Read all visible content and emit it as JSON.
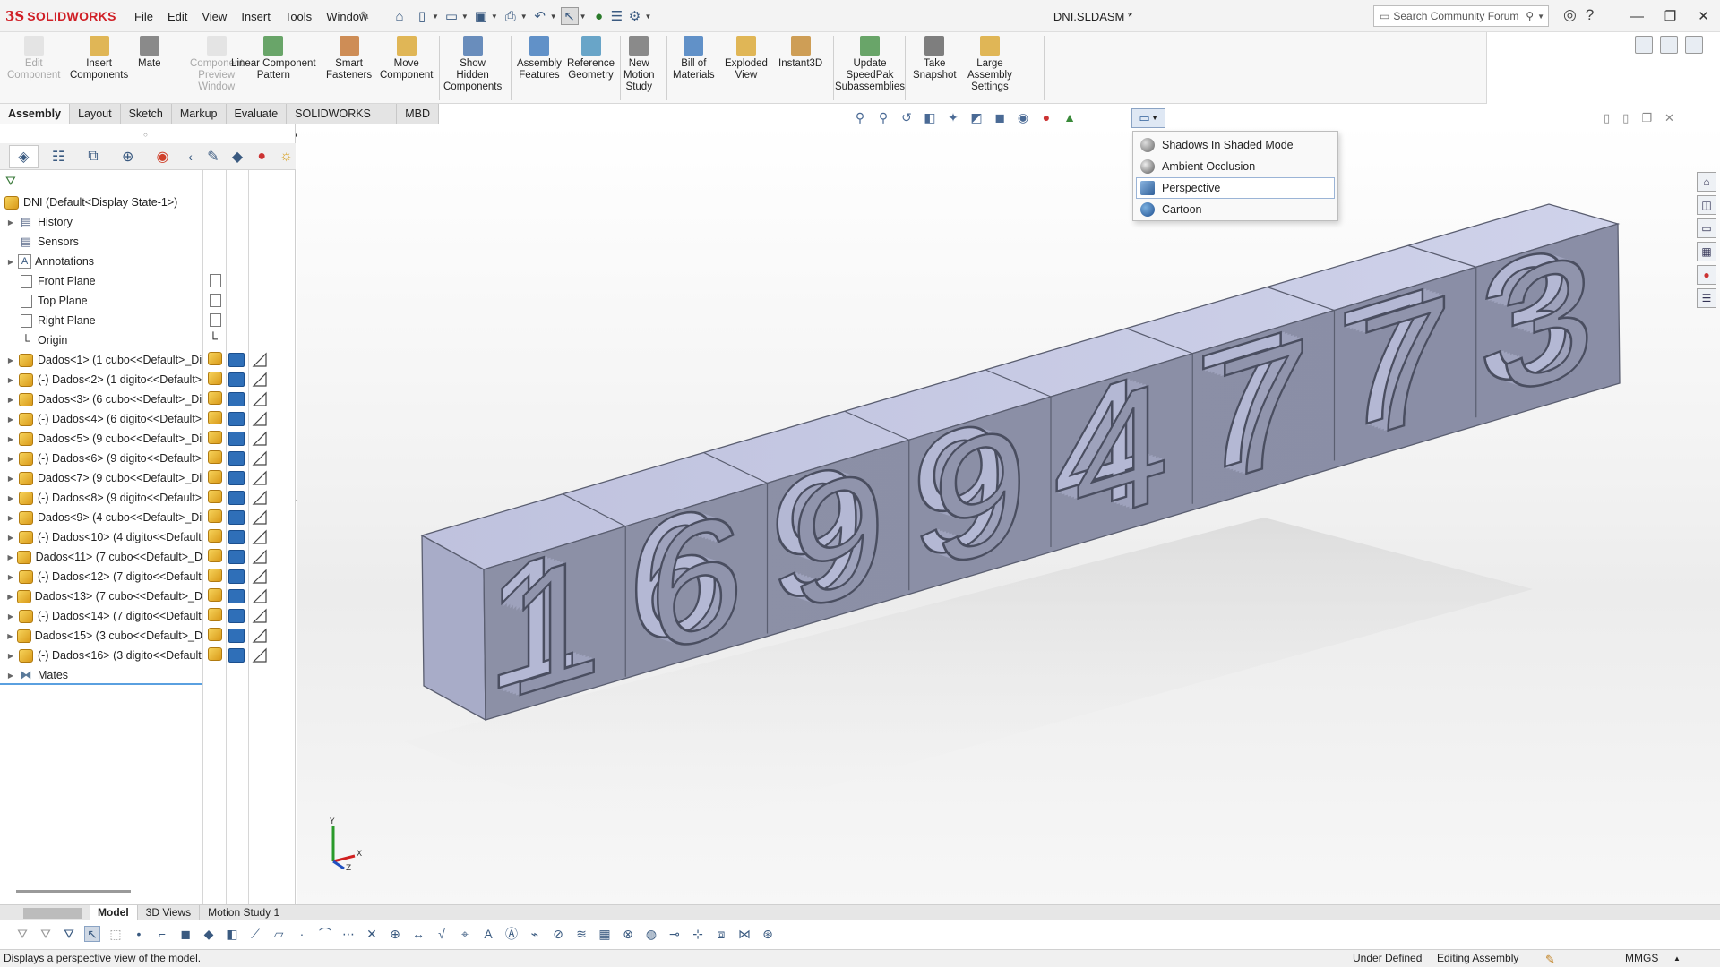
{
  "app": {
    "brand_ds": "3S",
    "brand_name": "SOLIDWORKS",
    "document_title": "DNI.SLDASM *"
  },
  "menu": [
    "File",
    "Edit",
    "View",
    "Insert",
    "Tools",
    "Window"
  ],
  "search": {
    "placeholder": "Search Community Forum"
  },
  "ribbon": {
    "items": [
      {
        "label": "Edit\nComponent",
        "enabled": false
      },
      {
        "label": "Insert\nComponents",
        "enabled": true
      },
      {
        "label": "Mate",
        "enabled": true
      },
      {
        "label": "Component\nPreview\nWindow",
        "enabled": false
      },
      {
        "label": "Linear Component\nPattern",
        "enabled": true
      },
      {
        "label": "Smart\nFasteners",
        "enabled": true
      },
      {
        "label": "Move\nComponent",
        "enabled": true
      },
      {
        "label": "Show\nHidden\nComponents",
        "enabled": true
      },
      {
        "label": "Assembly\nFeatures",
        "enabled": true
      },
      {
        "label": "Reference\nGeometry",
        "enabled": true
      },
      {
        "label": "New\nMotion\nStudy",
        "enabled": true
      },
      {
        "label": "Bill of\nMaterials",
        "enabled": true
      },
      {
        "label": "Exploded\nView",
        "enabled": true
      },
      {
        "label": "Instant3D",
        "enabled": true
      },
      {
        "label": "Update\nSpeedPak\nSubassemblies",
        "enabled": true
      },
      {
        "label": "Take\nSnapshot",
        "enabled": true
      },
      {
        "label": "Large\nAssembly\nSettings",
        "enabled": true
      }
    ]
  },
  "command_tabs": [
    {
      "label": "Assembly",
      "active": true
    },
    {
      "label": "Layout",
      "active": false
    },
    {
      "label": "Sketch",
      "active": false
    },
    {
      "label": "Markup",
      "active": false
    },
    {
      "label": "Evaluate",
      "active": false
    },
    {
      "label": "SOLIDWORKS Add-Ins",
      "active": false
    },
    {
      "label": "MBD",
      "active": false
    }
  ],
  "tree": {
    "root": "DNI  (Default<Display State-1>)",
    "items": [
      {
        "label": "History",
        "type": "folder",
        "expand": true
      },
      {
        "label": "Sensors",
        "type": "folder",
        "expand": false
      },
      {
        "label": "Annotations",
        "type": "annot",
        "expand": true
      },
      {
        "label": "Front Plane",
        "type": "plane",
        "expand": false
      },
      {
        "label": "Top Plane",
        "type": "plane",
        "expand": false
      },
      {
        "label": "Right Plane",
        "type": "plane",
        "expand": false
      },
      {
        "label": "Origin",
        "type": "origin",
        "expand": false
      },
      {
        "label": "Dados<1> (1 cubo<<Default>_Di",
        "type": "part",
        "expand": true
      },
      {
        "label": "(-) Dados<2> (1 digito<<Default>",
        "type": "part",
        "expand": true
      },
      {
        "label": "Dados<3> (6 cubo<<Default>_Di",
        "type": "part",
        "expand": true
      },
      {
        "label": "(-) Dados<4> (6 digito<<Default>",
        "type": "part",
        "expand": true
      },
      {
        "label": "Dados<5> (9 cubo<<Default>_Di",
        "type": "part",
        "expand": true
      },
      {
        "label": "(-) Dados<6> (9 digito<<Default>",
        "type": "part",
        "expand": true
      },
      {
        "label": "Dados<7> (9 cubo<<Default>_Di",
        "type": "part",
        "expand": true
      },
      {
        "label": "(-) Dados<8> (9 digito<<Default>",
        "type": "part",
        "expand": true
      },
      {
        "label": "Dados<9> (4 cubo<<Default>_Di",
        "type": "part",
        "expand": true
      },
      {
        "label": "(-) Dados<10> (4 digito<<Default",
        "type": "part",
        "expand": true
      },
      {
        "label": "Dados<11> (7 cubo<<Default>_D",
        "type": "part",
        "expand": true
      },
      {
        "label": "(-) Dados<12> (7 digito<<Default",
        "type": "part",
        "expand": true
      },
      {
        "label": "Dados<13> (7 cubo<<Default>_D",
        "type": "part",
        "expand": true
      },
      {
        "label": "(-) Dados<14> (7 digito<<Default",
        "type": "part",
        "expand": true
      },
      {
        "label": "Dados<15> (3 cubo<<Default>_D",
        "type": "part",
        "expand": true
      },
      {
        "label": "(-) Dados<16> (3 digito<<Default",
        "type": "part",
        "expand": true
      },
      {
        "label": "Mates",
        "type": "mates",
        "expand": true
      }
    ]
  },
  "display_menu": {
    "items": [
      {
        "label": "Shadows In Shaded Mode",
        "icon": "shadow-icon",
        "highlighted": false
      },
      {
        "label": "Ambient Occlusion",
        "icon": "ambient-occlusion-icon",
        "highlighted": false
      },
      {
        "label": "Perspective",
        "icon": "perspective-icon",
        "highlighted": true
      },
      {
        "label": "Cartoon",
        "icon": "cartoon-icon",
        "highlighted": false
      }
    ]
  },
  "model": {
    "digits": [
      "1",
      "6",
      "9",
      "9",
      "4",
      "7",
      "7",
      "3"
    ]
  },
  "bottom_tabs": [
    {
      "label": "Model",
      "active": true
    },
    {
      "label": "3D Views",
      "active": false
    },
    {
      "label": "Motion Study 1",
      "active": false
    }
  ],
  "status": {
    "message": "Displays a perspective view of the model.",
    "definition": "Under Defined",
    "mode": "Editing Assembly",
    "units": "MMGS"
  },
  "colors": {
    "brand": "#d01f26",
    "part_face_front": "#8e92a8",
    "part_face_top": "#c6c9e2",
    "part_face_side": "#a6aac4"
  }
}
